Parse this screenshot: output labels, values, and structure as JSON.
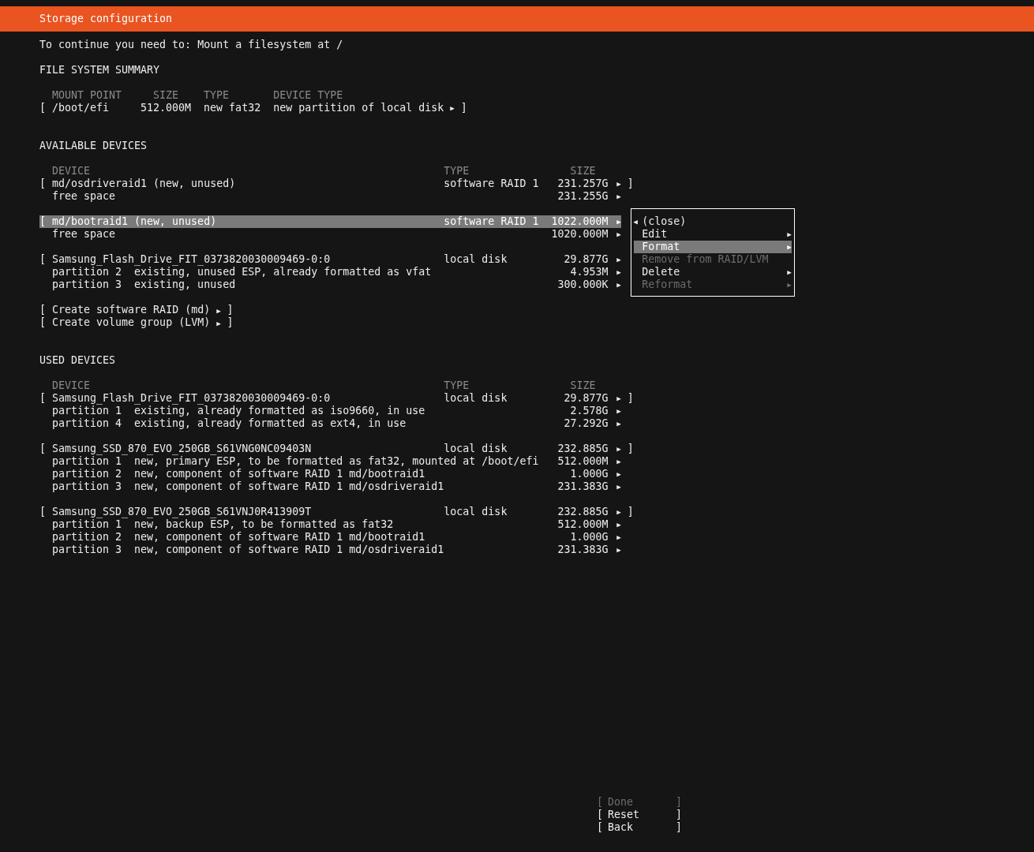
{
  "header": {
    "title": "Storage configuration"
  },
  "instruction": "To continue you need to: Mount a filesystem at /",
  "fs_summary": {
    "heading": "FILE SYSTEM SUMMARY",
    "columns": [
      "MOUNT POINT",
      "SIZE",
      "TYPE",
      "DEVICE TYPE"
    ],
    "rows": [
      {
        "open": "[",
        "mount_point": "/boot/efi",
        "size": "512.000M",
        "type": "new fat32",
        "device_type": "new partition of local disk",
        "arrow": "▶",
        "close": "]",
        "selected": false
      }
    ]
  },
  "available_devices": {
    "heading": "AVAILABLE DEVICES",
    "columns": [
      "DEVICE",
      "TYPE",
      "SIZE"
    ],
    "groups": [
      {
        "rows": [
          {
            "open": "[",
            "name": "md/osdriveraid1 (new, unused)",
            "type": "software RAID 1",
            "size": "231.257G",
            "arrow": "▶",
            "close": "]",
            "selected": false
          },
          {
            "name": "free space",
            "size": "231.255G",
            "arrow": "▶",
            "selected": false
          }
        ]
      },
      {
        "rows": [
          {
            "open": "[",
            "name": "md/bootraid1 (new, unused)",
            "type": "software RAID 1",
            "size": "1022.000M",
            "arrow": "▶",
            "selected": true,
            "menu": {
              "items": [
                {
                  "lead": "◀",
                  "label": "(close)",
                  "selected": false,
                  "disabled": false
                },
                {
                  "label": "Edit",
                  "trail": "▶",
                  "selected": false,
                  "disabled": false
                },
                {
                  "label": "Format",
                  "trail": "▶",
                  "selected": true,
                  "disabled": false
                },
                {
                  "label": "Remove from RAID/LVM",
                  "selected": false,
                  "disabled": true
                },
                {
                  "label": "Delete",
                  "trail": "▶",
                  "selected": false,
                  "disabled": false
                },
                {
                  "label": "Reformat",
                  "trail": "▶",
                  "selected": false,
                  "disabled": true
                }
              ]
            }
          },
          {
            "name": "free space",
            "size": "1020.000M",
            "arrow": "▶",
            "selected": false
          }
        ]
      },
      {
        "rows": [
          {
            "open": "[",
            "name": "Samsung_Flash_Drive_FIT_0373820030009469-0:0",
            "type": "local disk",
            "size": "29.877G",
            "arrow": "▶",
            "selected": false
          },
          {
            "name": "partition 2  existing, unused ESP, already formatted as vfat",
            "size": "4.953M",
            "arrow": "▶",
            "selected": false
          },
          {
            "name": "partition 3  existing, unused",
            "size": "300.000K",
            "arrow": "▶",
            "selected": false
          }
        ]
      }
    ],
    "actions": [
      {
        "open": "[",
        "label": "Create software RAID (md)",
        "arrow": "▶",
        "close": "]"
      },
      {
        "open": "[",
        "label": "Create volume group (LVM)",
        "arrow": "▶",
        "close": "]"
      }
    ]
  },
  "used_devices": {
    "heading": "USED DEVICES",
    "columns": [
      "DEVICE",
      "TYPE",
      "SIZE"
    ],
    "groups": [
      {
        "rows": [
          {
            "open": "[",
            "name": "Samsung_Flash_Drive_FIT_0373820030009469-0:0",
            "type": "local disk",
            "size": "29.877G",
            "arrow": "▶",
            "close": "]",
            "selected": false
          },
          {
            "name": "partition 1  existing, already formatted as iso9660, in use",
            "size": "2.578G",
            "arrow": "▶",
            "selected": false
          },
          {
            "name": "partition 4  existing, already formatted as ext4, in use",
            "size": "27.292G",
            "arrow": "▶",
            "selected": false
          }
        ]
      },
      {
        "rows": [
          {
            "open": "[",
            "name": "Samsung_SSD_870_EVO_250GB_S61VNG0NC09403N",
            "type": "local disk",
            "size": "232.885G",
            "arrow": "▶",
            "close": "]",
            "selected": false
          },
          {
            "name": "partition 1  new, primary ESP, to be formatted as fat32, mounted at /boot/efi",
            "size": "512.000M",
            "arrow": "▶",
            "selected": false
          },
          {
            "name": "partition 2  new, component of software RAID 1 md/bootraid1",
            "size": "1.000G",
            "arrow": "▶",
            "selected": false
          },
          {
            "name": "partition 3  new, component of software RAID 1 md/osdriveraid1",
            "size": "231.383G",
            "arrow": "▶",
            "selected": false
          }
        ]
      },
      {
        "rows": [
          {
            "open": "[",
            "name": "Samsung_SSD_870_EVO_250GB_S61VNJ0R413909T",
            "type": "local disk",
            "size": "232.885G",
            "arrow": "▶",
            "close": "]",
            "selected": false
          },
          {
            "name": "partition 1  new, backup ESP, to be formatted as fat32",
            "size": "512.000M",
            "arrow": "▶",
            "selected": false
          },
          {
            "name": "partition 2  new, component of software RAID 1 md/bootraid1",
            "size": "1.000G",
            "arrow": "▶",
            "selected": false
          },
          {
            "name": "partition 3  new, component of software RAID 1 md/osdriveraid1",
            "size": "231.383G",
            "arrow": "▶",
            "selected": false
          }
        ]
      }
    ]
  },
  "buttons": [
    {
      "open": "[",
      "label": "Done",
      "close": "]",
      "disabled": true
    },
    {
      "open": "[",
      "label": "Reset",
      "close": "]",
      "disabled": false
    },
    {
      "open": "[",
      "label": "Back",
      "close": "]",
      "disabled": false
    }
  ]
}
